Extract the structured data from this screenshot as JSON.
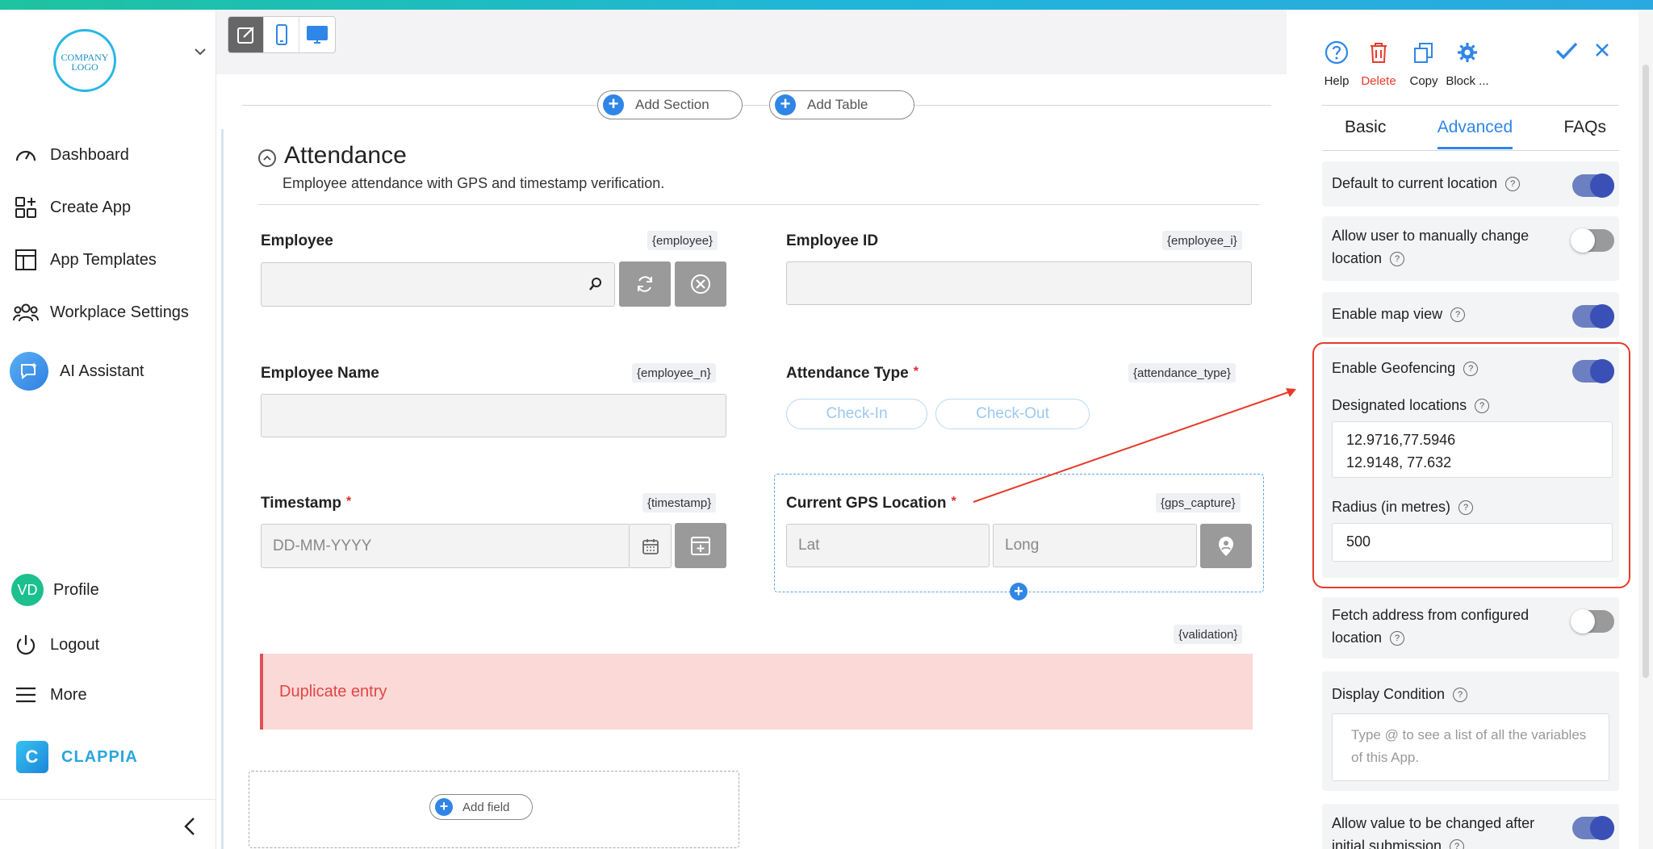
{
  "sidebar": {
    "logo_text": "COMPANY LOGO",
    "items": [
      {
        "label": "Dashboard",
        "icon": "dashboard-gauge-icon"
      },
      {
        "label": "Create App",
        "icon": "create-app-icon"
      },
      {
        "label": "App Templates",
        "icon": "templates-icon"
      },
      {
        "label": "Workplace Settings",
        "icon": "users-group-icon"
      },
      {
        "label": "AI Assistant",
        "icon": "ai-assistant-icon"
      }
    ],
    "bottom_items": [
      {
        "label": "Profile",
        "avatar": "VD"
      },
      {
        "label": "Logout",
        "icon": "power-icon"
      },
      {
        "label": "More",
        "icon": "menu-icon"
      }
    ],
    "brand": "CLAPPIA"
  },
  "toolbar": {
    "add_section": "Add Section",
    "add_table": "Add Table"
  },
  "section": {
    "title": "Attendance",
    "description": "Employee attendance with GPS and timestamp verification."
  },
  "fields": {
    "employee": {
      "label": "Employee",
      "tag": "{employee}"
    },
    "employee_id": {
      "label": "Employee ID",
      "tag": "{employee_i}"
    },
    "employee_name": {
      "label": "Employee Name",
      "tag": "{employee_n}"
    },
    "attendance_type": {
      "label": "Attendance Type",
      "required": "*",
      "tag": "{attendance_type}",
      "options": [
        "Check-In",
        "Check-Out"
      ]
    },
    "timestamp": {
      "label": "Timestamp",
      "required": "*",
      "tag": "{timestamp}",
      "placeholder": "DD-MM-YYYY"
    },
    "gps": {
      "label": "Current GPS Location",
      "required": "*",
      "tag": "{gps_capture}",
      "lat_placeholder": "Lat",
      "long_placeholder": "Long"
    },
    "validation": {
      "tag": "{validation}",
      "message": "Duplicate entry"
    }
  },
  "add_field": "Add field",
  "panel": {
    "tools": [
      {
        "label": "Help",
        "icon": "help-circle-icon"
      },
      {
        "label": "Delete",
        "icon": "trash-icon"
      },
      {
        "label": "Copy",
        "icon": "copy-icon"
      },
      {
        "label": "Block ...",
        "icon": "gear-icon"
      }
    ],
    "tabs": [
      "Basic",
      "Advanced",
      "FAQs"
    ],
    "active_tab": "Advanced",
    "options": {
      "default_location": {
        "label": "Default to current location",
        "enabled": true
      },
      "manual_change": {
        "label": "Allow user to manually change location",
        "enabled": false
      },
      "map_view": {
        "label": "Enable map view",
        "enabled": true
      },
      "geofencing": {
        "label": "Enable Geofencing",
        "enabled": true
      },
      "designated_label": "Designated locations",
      "designated_values": [
        "12.9716,77.5946",
        "12.9148, 77.632"
      ],
      "radius_label": "Radius (in metres)",
      "radius_value": "500",
      "fetch_address": {
        "label": "Fetch address from configured location",
        "enabled": false
      },
      "display_condition_label": "Display Condition",
      "display_condition_placeholder": "Type @ to see a list of all the variables of this App.",
      "allow_change": {
        "label": "Allow value to be changed after initial submission",
        "enabled": true
      }
    }
  },
  "colors": {
    "accent": "#2f86e6",
    "toggle_on": "#3a50b6",
    "error_bg": "#fbd9d7",
    "error_text": "#e04545",
    "highlight": "#e83a2a"
  }
}
